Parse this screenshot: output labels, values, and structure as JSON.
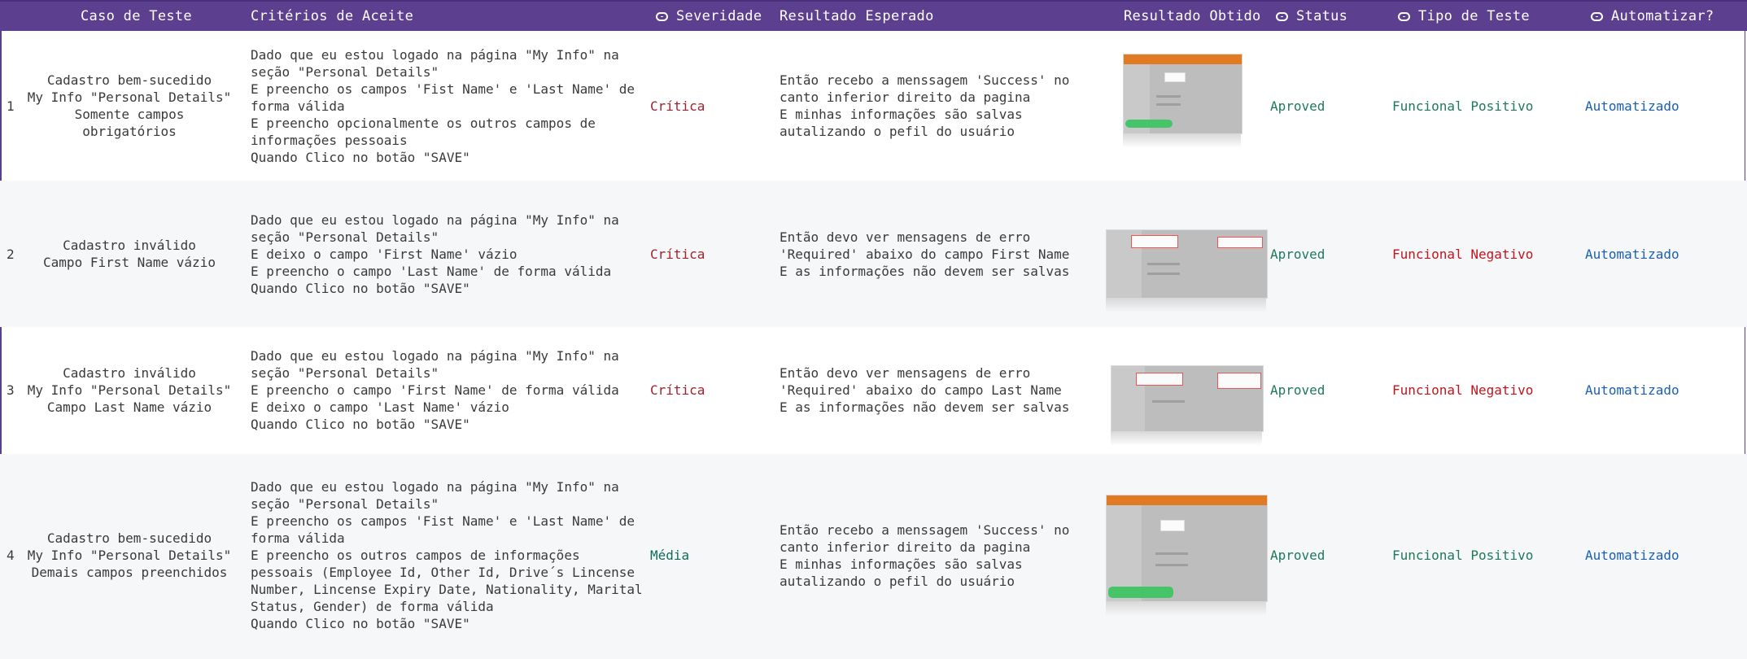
{
  "header": {
    "caso": "Caso de Teste",
    "criterios": "Critérios de Aceite",
    "severidade": "Severidade",
    "resultado_esperado": "Resultado Esperado",
    "resultado_obtido": "Resultado Obtido",
    "status": "Status",
    "tipo": "Tipo de Teste",
    "automatizar": "Automatizar?"
  },
  "rows": [
    {
      "num": "1",
      "caso": "Cadastro bem-sucedido\nMy Info \"Personal Details\"\nSomente campos\nobrigatórios",
      "criterios": "Dado que eu estou logado na página \"My Info\" na\nseção \"Personal Details\"\nE preencho os campos 'Fist Name' e 'Last Name' de\nforma válida\nE preencho opcionalmente os outros campos de\ninformações pessoais\nQuando Clico no botão \"SAVE\"",
      "severidade": "Crítica",
      "resultado": "Então recebo a menssagem 'Success' no\ncanto inferior direito da pagina\nE minhas informações são salvas\nautalizando o pefil do usuário",
      "status": "Aproved",
      "tipo": "Funcional Positivo",
      "automatizar": "Automatizado"
    },
    {
      "num": "2",
      "caso": "Cadastro inválido\nCampo First Name vázio",
      "criterios": "Dado que eu estou logado na página \"My Info\" na\nseção \"Personal Details\"\nE deixo o campo 'First Name' vázio\nE preencho o campo 'Last Name' de forma válida\nQuando Clico no botão \"SAVE\"",
      "severidade": "Crítica",
      "resultado": "Então devo ver mensagens de erro\n'Required' abaixo do campo First Name\nE as informações não devem ser salvas",
      "status": "Aproved",
      "tipo": "Funcional Negativo",
      "automatizar": "Automatizado"
    },
    {
      "num": "3",
      "caso": "Cadastro inválido\nMy Info \"Personal Details\"\nCampo Last Name vázio",
      "criterios": "Dado que eu estou logado na página \"My Info\" na\nseção \"Personal Details\"\nE preencho o campo 'First Name' de forma válida\nE deixo o campo 'Last Name' vázio\nQuando Clico no botão \"SAVE\"",
      "severidade": "Crítica",
      "resultado": "Então devo ver mensagens de erro\n'Required' abaixo do campo Last Name\nE as informações não devem ser salvas",
      "status": "Aproved",
      "tipo": "Funcional Negativo",
      "automatizar": "Automatizado"
    },
    {
      "num": "4",
      "caso": "Cadastro bem-sucedido\nMy Info \"Personal Details\"\nDemais campos preenchidos",
      "criterios": "Dado que eu estou logado na página \"My Info\" na\nseção \"Personal Details\"\nE preencho os campos 'Fist Name' e 'Last Name' de\nforma válida\nE preencho os outros campos de informações\npessoais (Employee Id, Other Id, Drive´s Lincense\nNumber, Lincense Expiry Date, Nationality, Marital\nStatus, Gender) de forma válida\nQuando Clico no botão \"SAVE\"",
      "severidade": "Média",
      "resultado": "Então recebo a menssagem 'Success' no\ncanto inferior direito da pagina\nE minhas informações são salvas\nautalizando o pefil do usuário",
      "status": "Aproved",
      "tipo": "Funcional Positivo",
      "automatizar": "Automatizado"
    }
  ],
  "colors": {
    "header_bg": "#5c3f8f",
    "critica": "#a3212c",
    "media": "#0f6b5a",
    "aproved": "#1e7a57",
    "positivo": "#1e7a57",
    "negativo": "#c4141d",
    "automatizado": "#1a5fb4"
  }
}
